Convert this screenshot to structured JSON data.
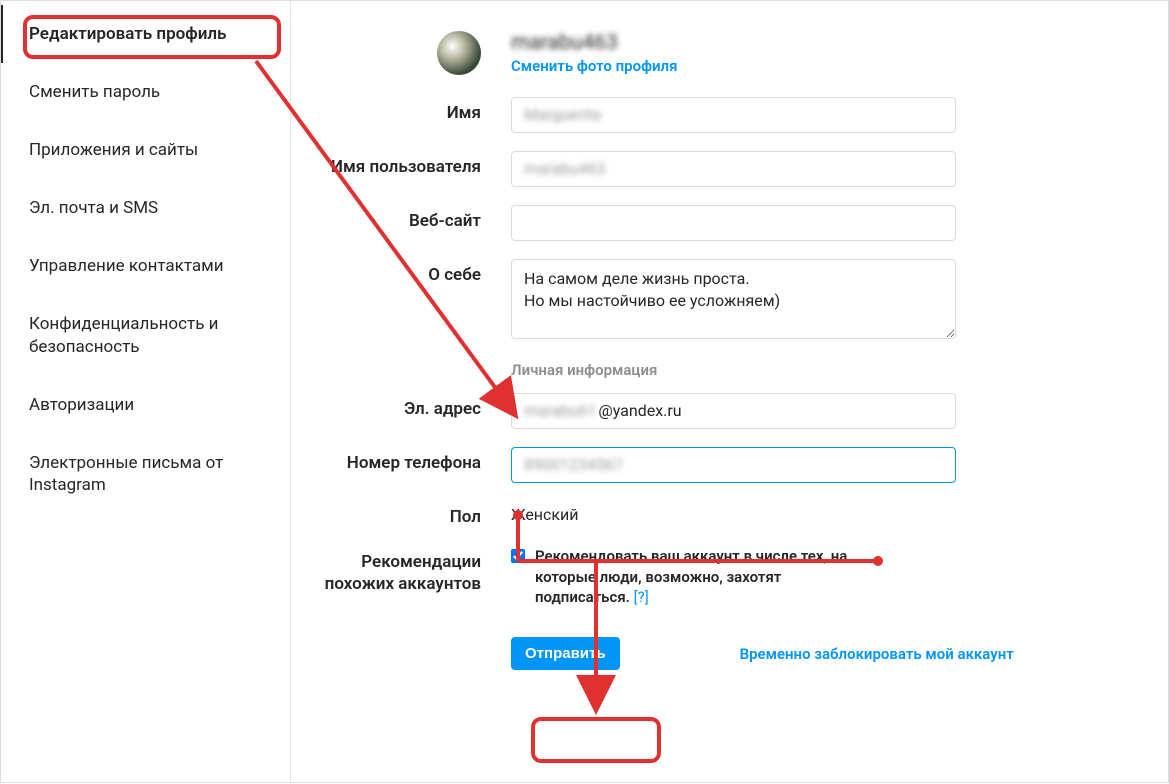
{
  "sidebar": {
    "items": [
      {
        "label": "Редактировать профиль",
        "active": true
      },
      {
        "label": "Сменить пароль",
        "active": false
      },
      {
        "label": "Приложения и сайты",
        "active": false
      },
      {
        "label": "Эл. почта и SMS",
        "active": false
      },
      {
        "label": "Управление контактами",
        "active": false
      },
      {
        "label": "Конфиденциальность и безопасность",
        "active": false
      },
      {
        "label": "Авторизации",
        "active": false
      },
      {
        "label": "Электронные письма от Instagram",
        "active": false
      }
    ]
  },
  "profile": {
    "username_blurred": "marabu463",
    "change_photo": "Сменить фото профиля",
    "name_blurred": "Marguerite",
    "username_field_blurred": "marabu463",
    "website": "",
    "bio": "На самом деле жизнь проста.\nНо мы настойчиво ее усложняем)",
    "email_blurred": "marabu61",
    "email_domain": "@yandex.ru",
    "phone_blurred": "89001234567",
    "gender": "Женский",
    "recommend_text": "Рекомендовать ваш аккаунт в числе тех, на которые люди, возможно, захотят подписаться.",
    "recommend_help": "[?]"
  },
  "labels": {
    "name": "Имя",
    "username": "Имя пользователя",
    "website": "Веб-сайт",
    "bio": "О себе",
    "personal_info_header": "Личная информация",
    "email": "Эл. адрес",
    "phone": "Номер телефона",
    "gender": "Пол",
    "recommendations": "Рекомендации похожих аккаунтов"
  },
  "actions": {
    "submit": "Отправить",
    "disable_account": "Временно заблокировать мой аккаунт"
  }
}
